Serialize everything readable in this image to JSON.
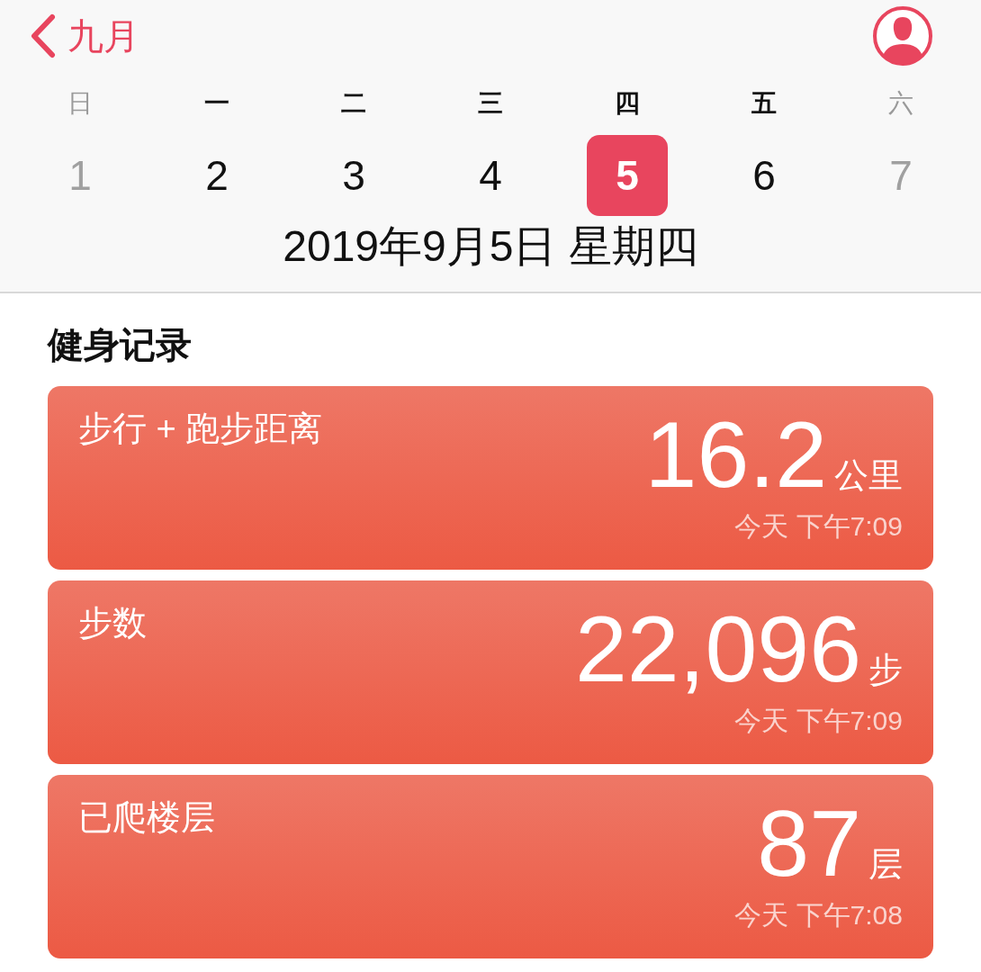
{
  "nav": {
    "back_label": "九月"
  },
  "weekdays": [
    {
      "label": "日",
      "dimmed": true
    },
    {
      "label": "一",
      "dimmed": false
    },
    {
      "label": "二",
      "dimmed": false
    },
    {
      "label": "三",
      "dimmed": false
    },
    {
      "label": "四",
      "dimmed": false
    },
    {
      "label": "五",
      "dimmed": false
    },
    {
      "label": "六",
      "dimmed": true
    }
  ],
  "dates": [
    {
      "label": "1",
      "dimmed": true,
      "selected": false
    },
    {
      "label": "2",
      "dimmed": false,
      "selected": false
    },
    {
      "label": "3",
      "dimmed": false,
      "selected": false
    },
    {
      "label": "4",
      "dimmed": false,
      "selected": false
    },
    {
      "label": "5",
      "dimmed": false,
      "selected": true
    },
    {
      "label": "6",
      "dimmed": false,
      "selected": false
    },
    {
      "label": "7",
      "dimmed": true,
      "selected": false
    }
  ],
  "selected_date": "2019年9月5日 星期四",
  "section_title": "健身记录",
  "cards": [
    {
      "title": "步行 + 跑步距离",
      "value": "16.2",
      "unit": "公里",
      "time": "今天 下午7:09"
    },
    {
      "title": "步数",
      "value": "22,096",
      "unit": "步",
      "time": "今天 下午7:09"
    },
    {
      "title": "已爬楼层",
      "value": "87",
      "unit": "层",
      "time": "今天 下午7:08"
    }
  ]
}
